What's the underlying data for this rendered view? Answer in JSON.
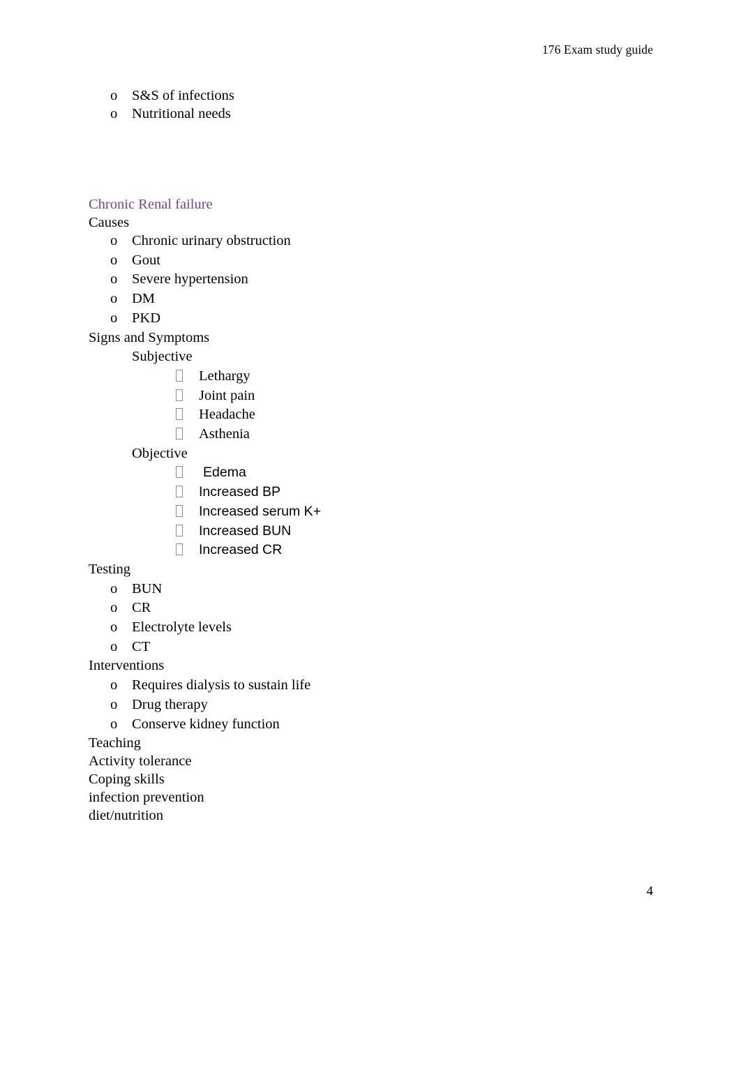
{
  "document": {
    "header": "176 Exam study guide",
    "page_number": "4",
    "accent_color": "#7b3f98",
    "text_color": "#000000",
    "background_color": "#ffffff"
  },
  "markers": {
    "level2": "o",
    "level3": "missing-glyph-box"
  },
  "intro_list": [
    "S&S of infections",
    "Nutritional needs"
  ],
  "section": {
    "title": "Chronic Renal failure",
    "causes": {
      "label": "Causes",
      "items": [
        "Chronic urinary obstruction",
        "Gout",
        "Severe hypertension",
        "DM",
        "PKD"
      ]
    },
    "signs_and_symptoms": {
      "label": "Signs and Symptoms",
      "subjective": {
        "label": "Subjective",
        "items": [
          "Lethargy",
          "Joint pain",
          "Headache",
          "Asthenia"
        ]
      },
      "objective": {
        "label": "Objective",
        "items": [
          "Edema",
          "Increased BP",
          "Increased serum K+",
          "Increased BUN",
          "Increased CR"
        ]
      }
    },
    "testing": {
      "label": "Testing",
      "items": [
        "BUN",
        "CR",
        "Electrolyte levels",
        "CT"
      ]
    },
    "interventions": {
      "label": "Interventions",
      "items": [
        "Requires dialysis to sustain life",
        "Drug therapy",
        "Conserve kidney function"
      ]
    },
    "trailing_lines": [
      "Teaching",
      "Activity tolerance",
      "Coping skills",
      "infection prevention",
      "diet/nutrition"
    ]
  }
}
